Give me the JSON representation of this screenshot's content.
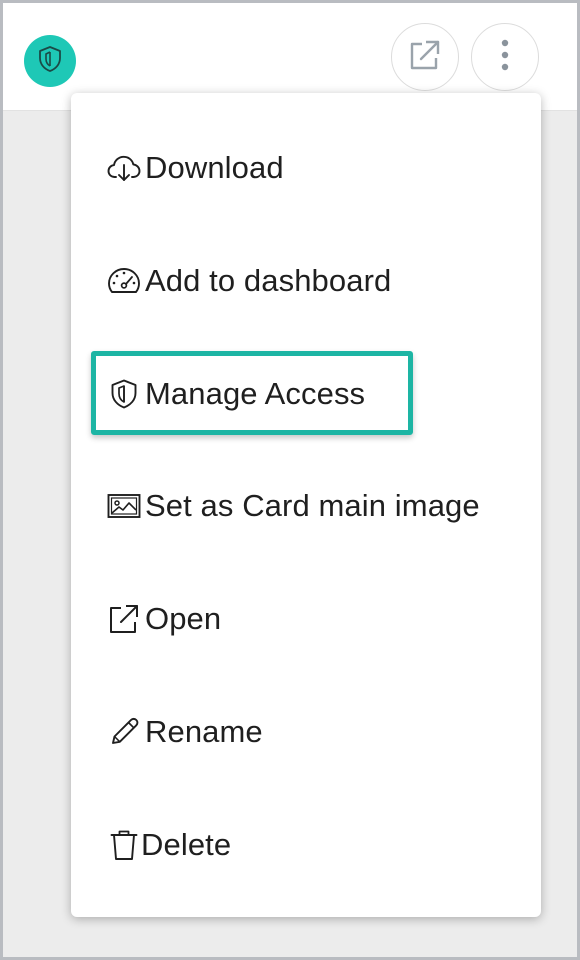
{
  "colors": {
    "accent": "#1ec8b6",
    "highlight": "#1db5a4",
    "icon_grey": "#8a939c",
    "text": "#1f1f1f"
  },
  "header": {
    "badge_icon": "shield-icon",
    "open_icon": "external-link-icon",
    "more_icon": "vertical-ellipsis-icon"
  },
  "menu": {
    "items": [
      {
        "label": "Download",
        "icon": "cloud-download-icon"
      },
      {
        "label": "Add to dashboard",
        "icon": "dashboard-gauge-icon"
      },
      {
        "label": "Manage Access",
        "icon": "shield-icon",
        "highlighted": true
      },
      {
        "label": "Set as Card main image",
        "icon": "image-icon"
      },
      {
        "label": "Open",
        "icon": "external-link-icon"
      },
      {
        "label": "Rename",
        "icon": "pencil-icon"
      },
      {
        "label": "Delete",
        "icon": "trash-icon"
      }
    ]
  }
}
